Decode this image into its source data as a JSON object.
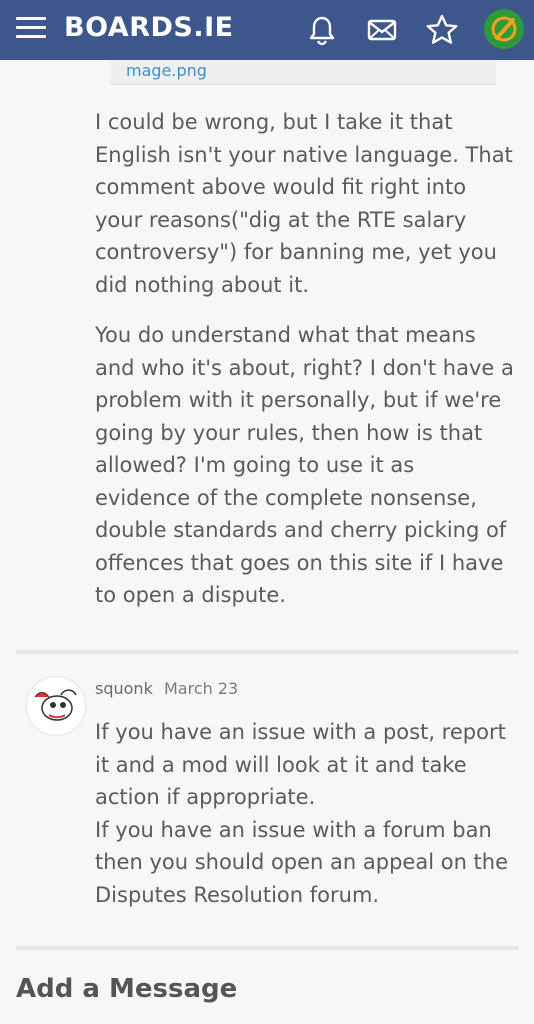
{
  "header": {
    "logo_text": "BOARDS.IE",
    "icons": [
      "menu-icon",
      "bell-icon",
      "mail-icon",
      "star-icon",
      "avatar"
    ]
  },
  "attachment": {
    "name": "mage.png"
  },
  "quote": {
    "paragraphs": [
      "I could be wrong, but I take it that English isn't your native language. That comment above would fit right into your reasons(\"dig at the RTE salary controversy\") for banning me, yet you did nothing about it.",
      "You do understand what that means and who it's about, right? I don't have a problem with it personally, but if we're going by your rules, then how is that allowed? I'm going to use it as evidence of the complete nonsense, double standards and cherry picking of offences that goes on this site if I have to open a dispute."
    ]
  },
  "reply": {
    "author": "squonk",
    "date": "March 23",
    "lines": [
      "If you have an issue with a post, report it and a mod will look at it and take action if appropriate.",
      "If you have an issue with a forum ban then you should open an appeal on the Disputes Resolution forum."
    ]
  },
  "composer": {
    "title": "Add a Message"
  },
  "colors": {
    "header_bg": "#3d568c",
    "link": "#3b8fd0",
    "text": "#5b5b5b"
  }
}
